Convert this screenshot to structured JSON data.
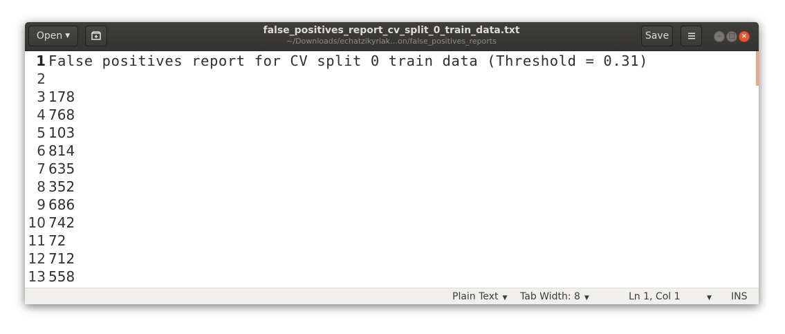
{
  "window": {
    "title": "false_positives_report_cv_split_0_train_data.txt",
    "path": "~/Downloads/echatzikyriak…on/false_positives_reports"
  },
  "header": {
    "open_label": "Open",
    "save_label": "Save",
    "new_tab_icon": "new-document-icon",
    "menu_icon": "hamburger-menu-icon"
  },
  "editor": {
    "current_line": 1,
    "lines": [
      {
        "number": "1",
        "text": "False positives report for CV split 0 train data (Threshold = 0.31)"
      },
      {
        "number": "2",
        "text": ""
      },
      {
        "number": "3",
        "text": "178"
      },
      {
        "number": "4",
        "text": "768"
      },
      {
        "number": "5",
        "text": "103"
      },
      {
        "number": "6",
        "text": "814"
      },
      {
        "number": "7",
        "text": "635"
      },
      {
        "number": "8",
        "text": "352"
      },
      {
        "number": "9",
        "text": "686"
      },
      {
        "number": "10",
        "text": "742"
      },
      {
        "number": "11",
        "text": "72"
      },
      {
        "number": "12",
        "text": "712"
      },
      {
        "number": "13",
        "text": "558"
      }
    ]
  },
  "statusbar": {
    "language": "Plain Text",
    "tab_width": "Tab Width: 8",
    "position": "Ln 1, Col 1",
    "mode": "INS"
  },
  "colors": {
    "titlebar": "#3c3b37",
    "close_button": "#e8582e",
    "scroll_indicator": "#f3a282"
  }
}
